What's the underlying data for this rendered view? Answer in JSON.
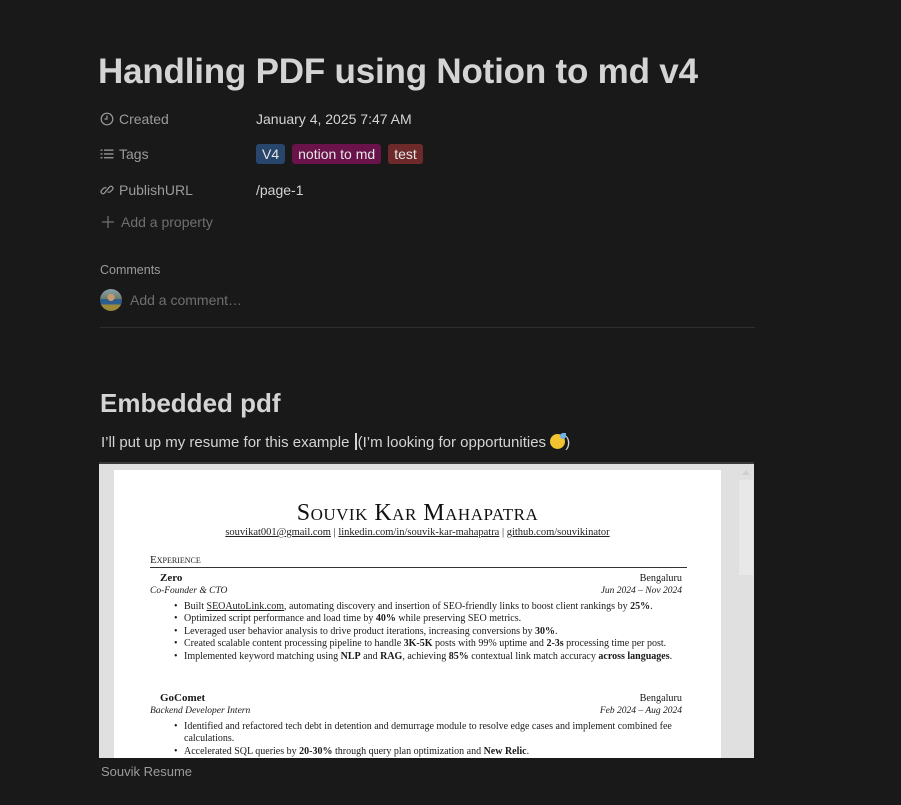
{
  "page": {
    "title": "Handling PDF using Notion to md v4"
  },
  "properties": [
    {
      "icon": "clock-icon",
      "label": "Created",
      "value": "January 4, 2025 7:47 AM"
    },
    {
      "icon": "list-icon",
      "label": "Tags",
      "tags": [
        {
          "label": "V4",
          "color": "#28456c"
        },
        {
          "label": "notion to md",
          "color": "#69134a"
        },
        {
          "label": "test",
          "color": "#6e2a2a"
        }
      ]
    },
    {
      "icon": "link-icon",
      "label": "PublishURL",
      "value": "/page-1"
    }
  ],
  "add_property_label": "Add a property",
  "comments": {
    "label": "Comments",
    "placeholder": "Add a comment…"
  },
  "content": {
    "heading": "Embedded pdf",
    "paragraph_before_caret": "I’ll put up my resume for this example ",
    "paragraph_after_caret": "(I’m looking for opportunities ",
    "paragraph_end": ")",
    "emoji": "grinning-face-with-sweat"
  },
  "pdf": {
    "caption": "Souvik Resume",
    "resume": {
      "name": "Souvik Kar Mahapatra",
      "contact": [
        "souvikat001@gmail.com",
        "linkedin.com/in/souvik-kar-mahapatra",
        "github.com/souvikinator"
      ],
      "separator": " | ",
      "section": "Experience",
      "jobs": [
        {
          "company": "Zero",
          "location": "Bengaluru",
          "role": "Co-Founder & CTO",
          "dates": "Jun 2024 – Nov 2024",
          "bullets": [
            "Built <u>SEOAutoLink.com</u>, automating discovery and insertion of SEO-friendly links to boost client rankings by <b>25%</b>.",
            "Optimized script performance and load time by <b>40%</b> while preserving SEO metrics.",
            "Leveraged user behavior analysis to drive product iterations, increasing conversions by <b>30%</b>.",
            "Created scalable content processing pipeline to handle <b>3K-5K</b> posts with 99% uptime and <b>2-3s</b> processing time per post.",
            "Implemented keyword matching using <b>NLP</b> and <b>RAG</b>, achieving <b>85%</b> contextual link match accuracy <b>across languages</b>."
          ]
        },
        {
          "company": "GoComet",
          "location": "Bengaluru",
          "role": "Backend Developer Intern",
          "dates": "Feb 2024 – Aug 2024",
          "bullets": [
            "Identified and refactored tech debt in detention and demurrage module to resolve edge cases and implement combined fee calculations.",
            "Accelerated SQL queries by <b>20-30%</b> through query plan optimization and <b>New Relic</b>."
          ]
        }
      ]
    }
  }
}
